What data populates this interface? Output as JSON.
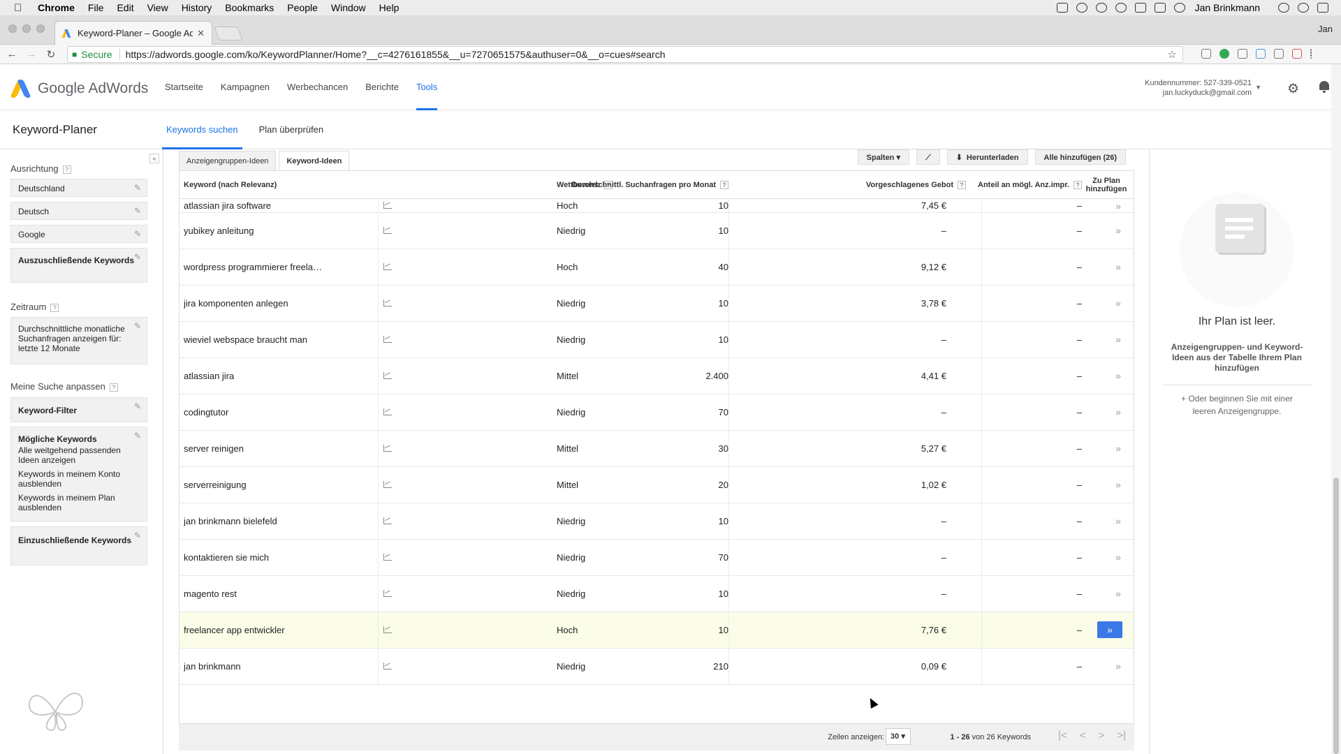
{
  "os_menu": {
    "app": "Chrome",
    "items": [
      "File",
      "Edit",
      "View",
      "History",
      "Bookmarks",
      "People",
      "Window",
      "Help"
    ],
    "user": "Jan Brinkmann"
  },
  "browser": {
    "tab_title": "Keyword-Planer – Google AdW",
    "profile": "Jan",
    "secure_label": "Secure",
    "url": "https://adwords.google.com/ko/KeywordPlanner/Home?__c=4276161855&__u=7270651575&authuser=0&__o=cues#search"
  },
  "app": {
    "logo_text": "Google AdWords",
    "nav": [
      "Startseite",
      "Kampagnen",
      "Werbechancen",
      "Berichte",
      "Tools"
    ],
    "customer_number": "Kundennummer: 527-339-0521",
    "email": "jan.luckyduck@gmail.com"
  },
  "page": {
    "title": "Keyword-Planer",
    "tabs": [
      "Keywords suchen",
      "Plan überprüfen"
    ]
  },
  "sidebar": {
    "targeting_heading": "Ausrichtung",
    "targeting": [
      "Deutschland",
      "Deutsch",
      "Google"
    ],
    "negative_keywords": "Auszuschließende Keywords",
    "date_heading": "Zeitraum",
    "date_text": "Durchschnittliche monatliche Suchanfragen anzeigen für: letzte 12 Monate",
    "customize_heading": "Meine Suche anpassen",
    "keyword_filter": "Keyword-Filter",
    "options_title": "Mögliche Keywords",
    "options": [
      "Alle weitgehend passenden Ideen anzeigen",
      "Keywords in meinem Konto ausblenden",
      "Keywords in meinem Plan ausblenden"
    ],
    "include_keywords": "Einzuschließende Keywords"
  },
  "content": {
    "tabs": [
      "Anzeigengruppen-Ideen",
      "Keyword-Ideen"
    ],
    "buttons": {
      "columns": "Spalten",
      "download": "Herunterladen",
      "add_all": "Alle hinzufügen (26)"
    },
    "headers": {
      "keyword": "Keyword (nach Relevanz)",
      "searches": "Durchschnittl. Suchanfragen pro Monat",
      "competition": "Wettbewerb",
      "bid": "Vorgeschlagenes Gebot",
      "share": "Anteil an mögl. Anz.impr.",
      "add": "Zu Plan hinzufügen"
    },
    "rows": [
      {
        "keyword": "atlassian jira software",
        "searches": "10",
        "competition": "Hoch",
        "bid": "7,45 €",
        "share": "–"
      },
      {
        "keyword": "yubikey anleitung",
        "searches": "10",
        "competition": "Niedrig",
        "bid": "–",
        "share": "–"
      },
      {
        "keyword": "wordpress programmierer freela…",
        "searches": "40",
        "competition": "Hoch",
        "bid": "9,12 €",
        "share": "–"
      },
      {
        "keyword": "jira komponenten anlegen",
        "searches": "10",
        "competition": "Niedrig",
        "bid": "3,78 €",
        "share": "–"
      },
      {
        "keyword": "wieviel webspace braucht man",
        "searches": "10",
        "competition": "Niedrig",
        "bid": "–",
        "share": "–"
      },
      {
        "keyword": "atlassian jira",
        "searches": "2.400",
        "competition": "Mittel",
        "bid": "4,41 €",
        "share": "–"
      },
      {
        "keyword": "codingtutor",
        "searches": "70",
        "competition": "Niedrig",
        "bid": "–",
        "share": "–"
      },
      {
        "keyword": "server reinigen",
        "searches": "30",
        "competition": "Mittel",
        "bid": "5,27 €",
        "share": "–"
      },
      {
        "keyword": "serverreinigung",
        "searches": "20",
        "competition": "Mittel",
        "bid": "1,02 €",
        "share": "–"
      },
      {
        "keyword": "jan brinkmann bielefeld",
        "searches": "10",
        "competition": "Niedrig",
        "bid": "–",
        "share": "–"
      },
      {
        "keyword": "kontaktieren sie mich",
        "searches": "70",
        "competition": "Niedrig",
        "bid": "–",
        "share": "–"
      },
      {
        "keyword": "magento rest",
        "searches": "10",
        "competition": "Niedrig",
        "bid": "–",
        "share": "–"
      },
      {
        "keyword": "freelancer app entwickler",
        "searches": "10",
        "competition": "Hoch",
        "bid": "7,76 €",
        "share": "–"
      },
      {
        "keyword": "jan brinkmann",
        "searches": "210",
        "competition": "Niedrig",
        "bid": "0,09 €",
        "share": "–"
      }
    ],
    "pager": {
      "rows_label": "Zeilen anzeigen:",
      "rows_value": "30",
      "range": "1 - 26",
      "range_suffix": "von 26 Keywords"
    }
  },
  "plan": {
    "empty_title": "Ihr Plan ist leer.",
    "hint": "Anzeigengruppen- und Keyword-Ideen aus der Tabelle Ihrem Plan hinzufügen",
    "hint2": "+ Oder beginnen Sie mit einer leeren Anzeigengruppe."
  }
}
